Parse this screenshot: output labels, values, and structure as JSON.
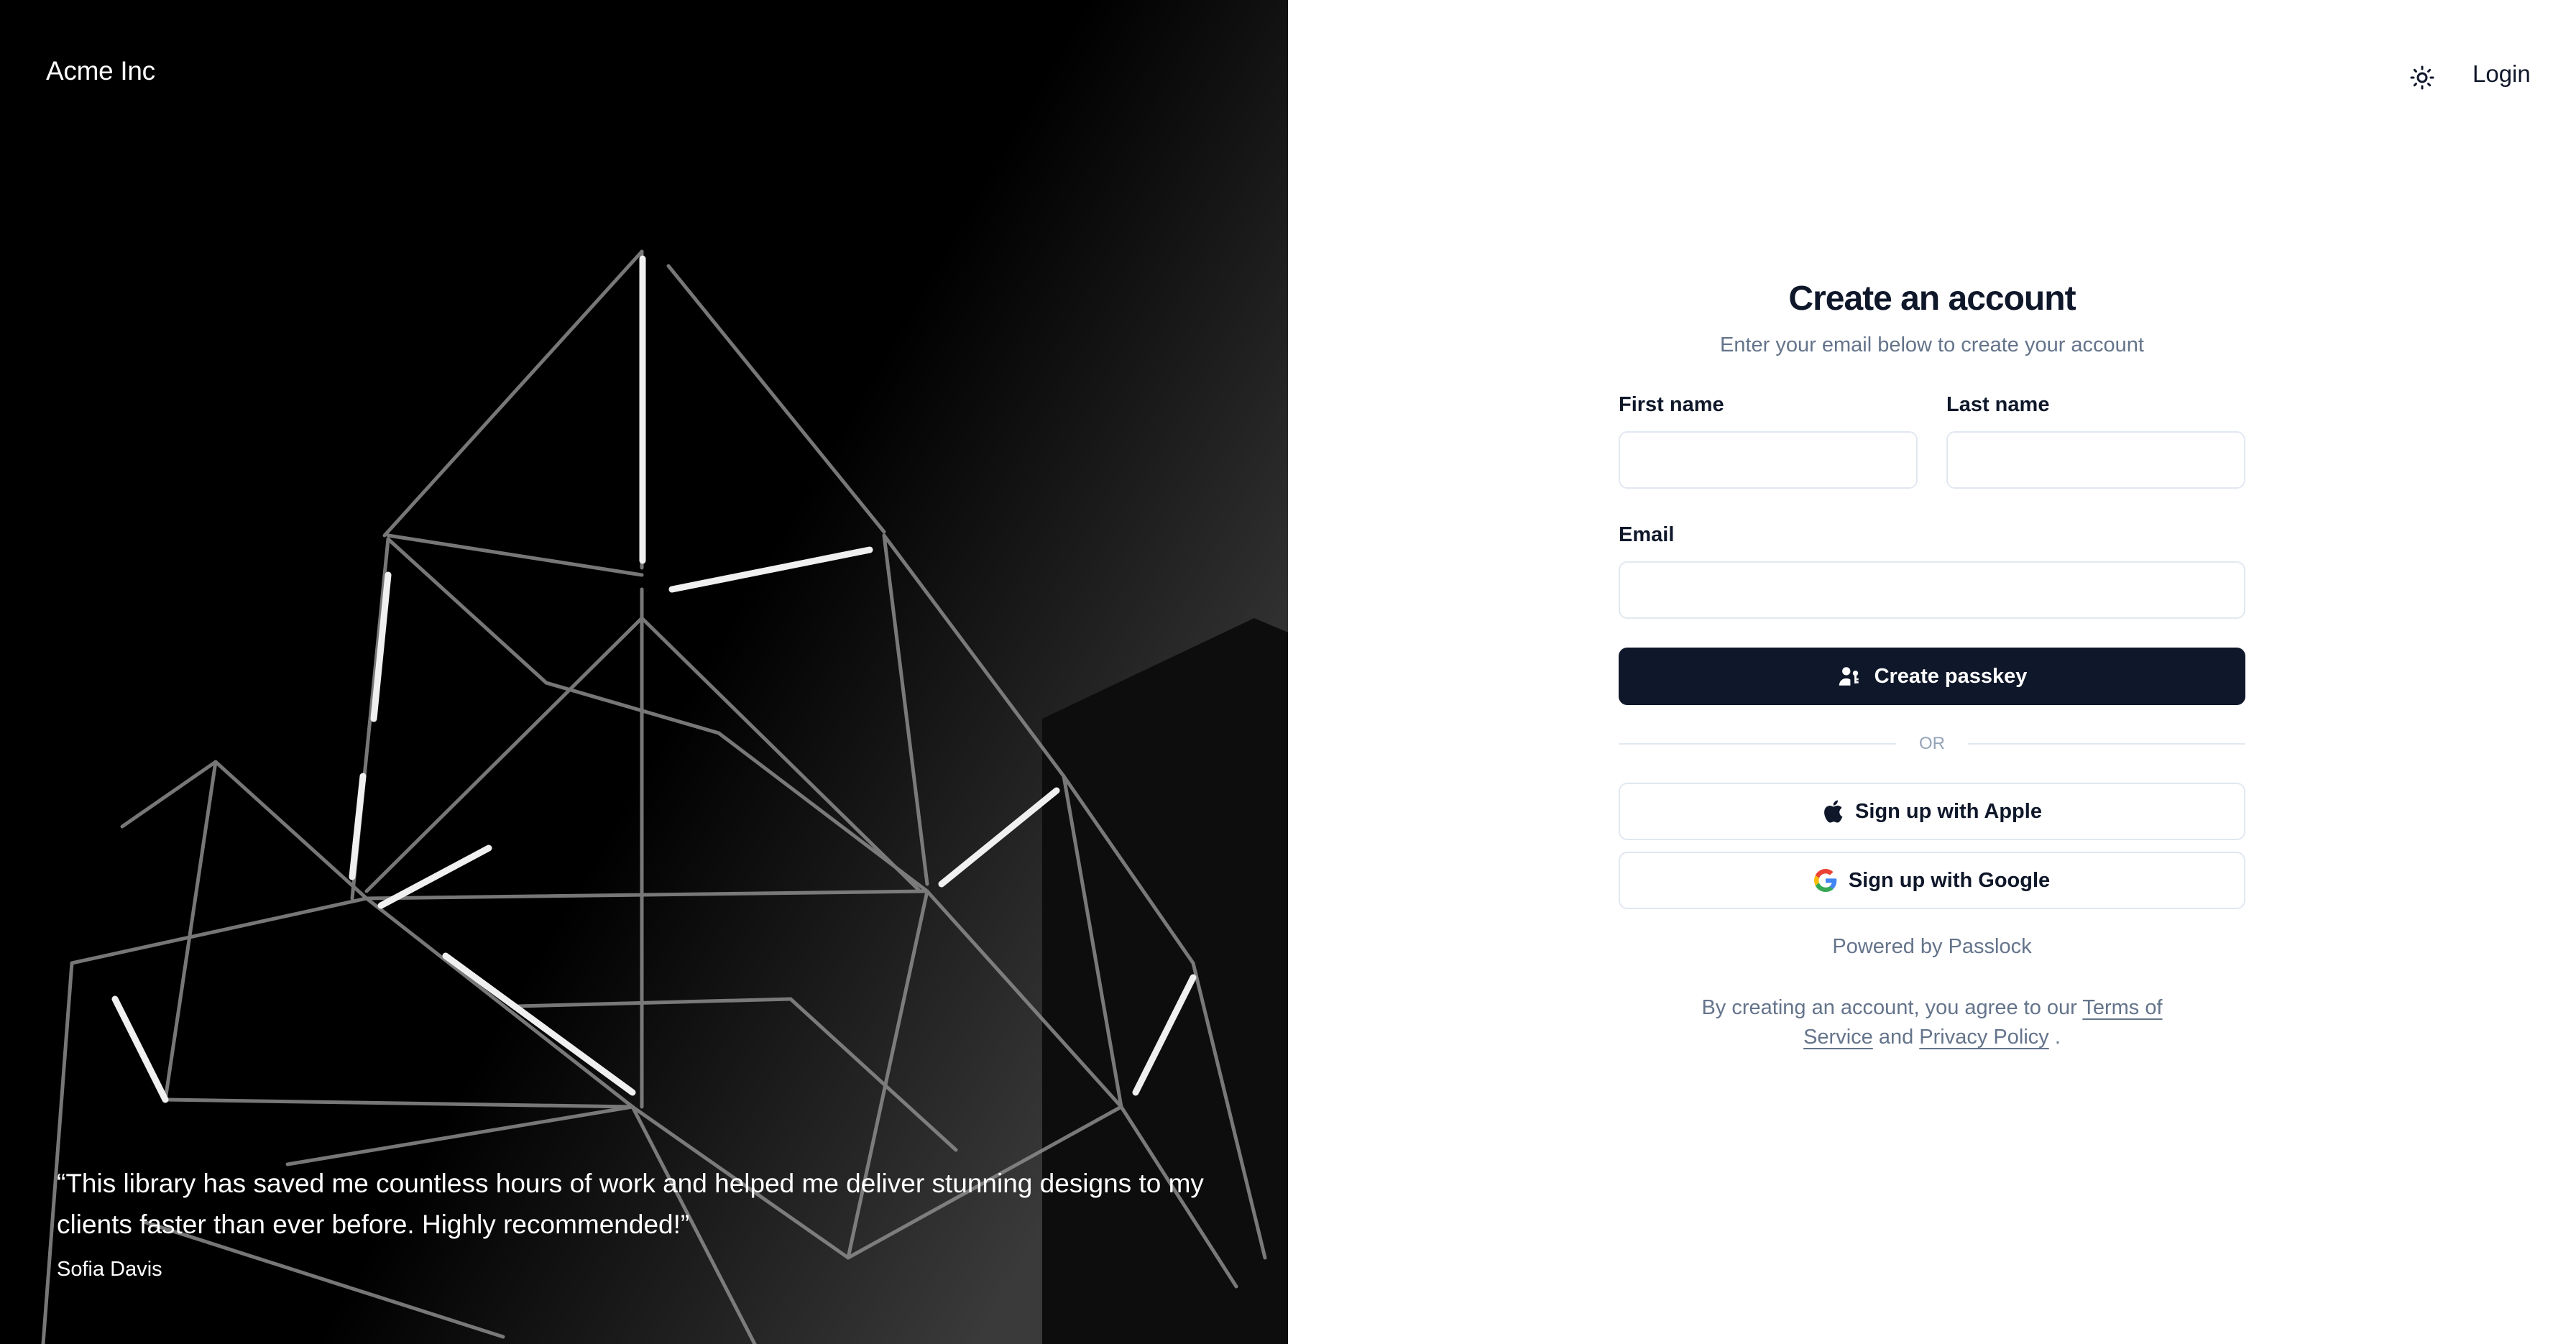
{
  "brand": {
    "name": "Acme Inc"
  },
  "header": {
    "theme_toggle_icon": "sun-icon",
    "login_label": "Login"
  },
  "hero": {
    "quote": "“This library has saved me countless hours of work and helped me deliver stunning designs to my clients faster than ever before. Highly recommended!”",
    "author": "Sofia Davis"
  },
  "form": {
    "title": "Create an account",
    "subtitle": "Enter your email below to create your account",
    "first_name_label": "First name",
    "first_name_value": "",
    "last_name_label": "Last name",
    "last_name_value": "",
    "email_label": "Email",
    "email_value": "",
    "create_passkey_label": "Create passkey",
    "create_passkey_icon": "user-key-icon",
    "divider_text": "OR",
    "apple_label": "Sign up with Apple",
    "apple_icon": "apple-icon",
    "google_label": "Sign up with Google",
    "google_icon": "google-icon",
    "powered_by": "Powered by Passlock",
    "terms_prefix": "By creating an account, you agree to our",
    "terms_link": "Terms of Service",
    "terms_and": "and",
    "privacy_link": "Privacy Policy",
    "terms_suffix": "."
  },
  "colors": {
    "primary": "#0f172a",
    "muted_text": "#64748b",
    "border": "#e2e8f0",
    "hero_background": "#000000"
  }
}
